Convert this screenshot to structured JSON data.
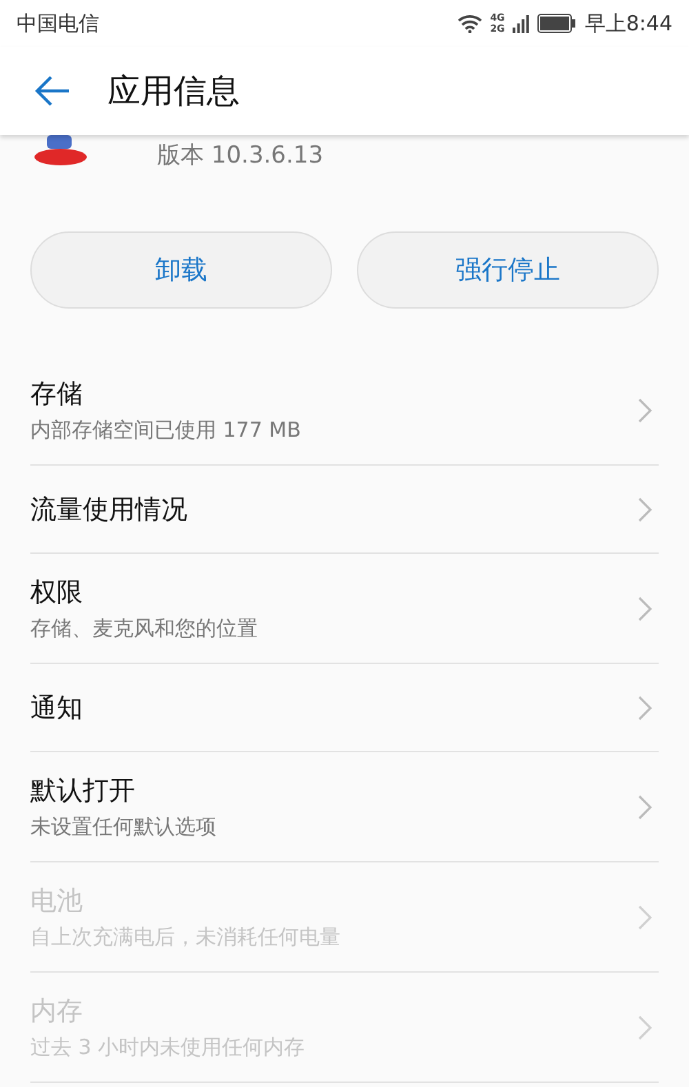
{
  "status_bar": {
    "carrier": "中国电信",
    "network": "4G",
    "network2": "2G",
    "time": "早上8:44"
  },
  "header": {
    "title": "应用信息"
  },
  "app": {
    "version": "版本 10.3.6.13"
  },
  "buttons": [
    {
      "label": "卸载"
    },
    {
      "label": "强行停止"
    }
  ],
  "rows": [
    {
      "title": "存储",
      "subtitle": "内部存储空间已使用 177 MB",
      "disabled": false
    },
    {
      "title": "流量使用情况",
      "disabled": false
    },
    {
      "title": "权限",
      "subtitle": "存储、麦克风和您的位置",
      "disabled": false
    },
    {
      "title": "通知",
      "disabled": false
    },
    {
      "title": "默认打开",
      "subtitle": "未设置任何默认选项",
      "disabled": false
    },
    {
      "title": "电池",
      "subtitle": "自上次充满电后，未消耗任何电量",
      "disabled": true
    },
    {
      "title": "内存",
      "subtitle": "过去 3 小时内未使用任何内存",
      "disabled": true
    }
  ]
}
